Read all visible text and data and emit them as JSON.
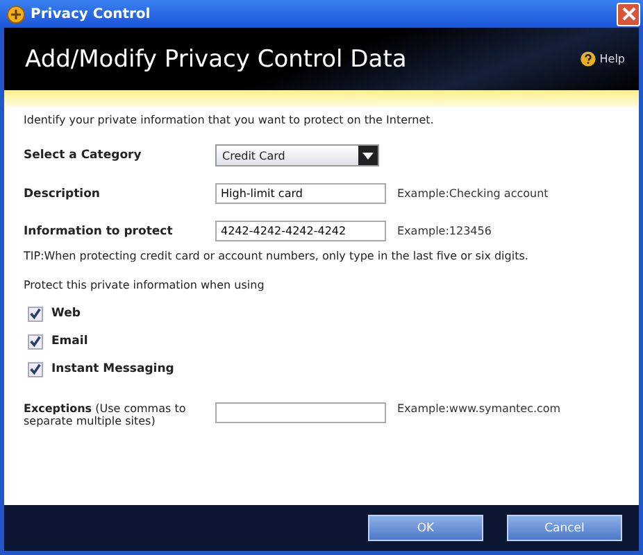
{
  "window": {
    "title": "Privacy Control"
  },
  "header": {
    "title": "Add/Modify Privacy Control Data",
    "help": "Help"
  },
  "intro": "Identify your private information that you want to protect on the Internet.",
  "fields": [
    {
      "kind": "dropdown",
      "label": "Select a Category",
      "value": "Credit Card"
    },
    {
      "kind": "text",
      "label": "Description",
      "value": "High-limit card",
      "example": "Example:Checking account"
    },
    {
      "kind": "text",
      "label": "Information to protect",
      "value": "4242-4242-4242-4242",
      "example": "Example:123456"
    }
  ],
  "tip": "TIP:When protecting credit card or account numbers, only type in the last five or six digits.",
  "protect_label": "Protect this private information when using",
  "options": [
    {
      "label": "Web",
      "checked": true
    },
    {
      "label": "Email",
      "checked": true
    },
    {
      "label": "Instant Messaging",
      "checked": true
    }
  ],
  "exceptions": {
    "label": "**Exceptions** (Use commas to separate multiple sites)",
    "example": "Example:www.symantec.com"
  },
  "buttons": [
    "OK",
    "Cancel"
  ]
}
